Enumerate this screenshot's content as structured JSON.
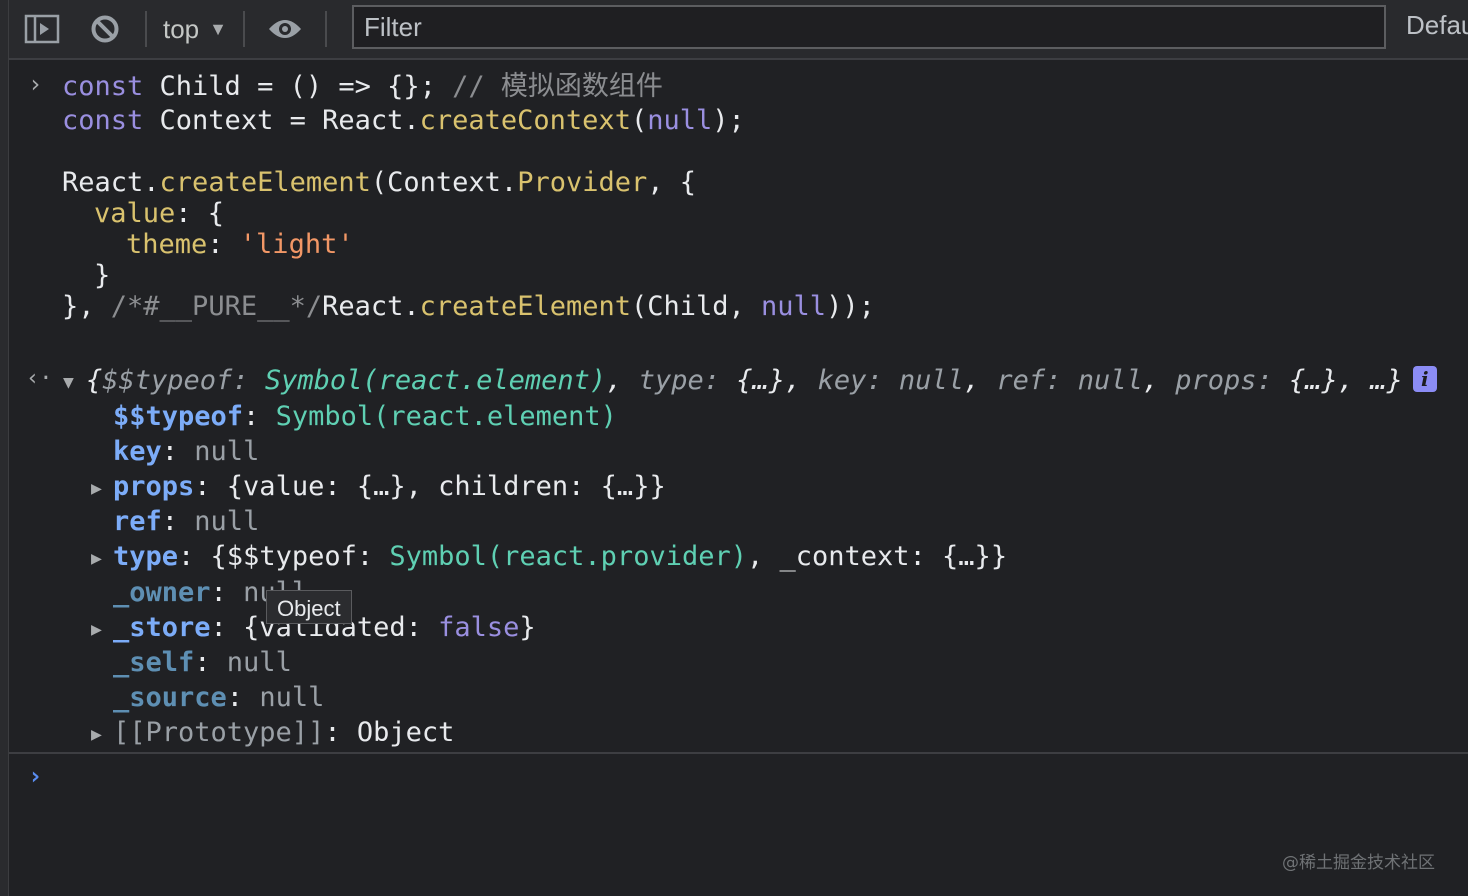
{
  "toolbar": {
    "context": "top",
    "filter_placeholder": "Filter",
    "levels_label": "Defau",
    "icons": [
      "sidebar-toggle-icon",
      "clear-console-icon",
      "eye-icon"
    ]
  },
  "input_code": {
    "l1": {
      "kw": "const",
      "ident": " Child = () => {}; ",
      "comment": "// 模拟函数组件"
    },
    "l2": {
      "kw": "const",
      "a": " Context = React.",
      "fn": "createContext",
      "b": "(",
      "nul": "null",
      "c": ");"
    },
    "l3": {
      "a": "React.",
      "fn": "createElement",
      "b": "(Context.",
      "prop": "Provider",
      "c": ", {"
    },
    "l4": {
      "prop": "value",
      "a": ": {"
    },
    "l5": {
      "prop": "theme",
      "a": ": ",
      "str": "'light'"
    },
    "l6": {
      "a": "}"
    },
    "l7": {
      "a": "}, ",
      "cmt": "/*#__PURE__*/",
      "b": "React.",
      "fn": "createElement",
      "c": "(Child, ",
      "nul": "null",
      "d": "));"
    }
  },
  "result": {
    "summary": {
      "open": "{",
      "k1": "$$typeof",
      "v1": "Symbol(react.element)",
      "k2": "type",
      "v2": "{…}",
      "k3": "key",
      "v3": "null",
      "k4": "ref",
      "v4": "null",
      "k5": "props",
      "v5": "{…}",
      "tail": "…}"
    },
    "rows": [
      {
        "key": "$$typeof",
        "value": "Symbol(react.element)"
      },
      {
        "key": "key",
        "value": "null"
      },
      {
        "key": "props",
        "value_a": "{value: {…}, ",
        "value_b": "children: {…}}"
      },
      {
        "key": "ref",
        "value": "null"
      },
      {
        "key": "type",
        "value_a": "{$$typeof: ",
        "value_sym": "Symbol(react.provider)",
        "value_b": ", _context: {…}}"
      },
      {
        "key": "_owner",
        "value": "null"
      },
      {
        "key": "_store",
        "value_a": "{validated: ",
        "value_bool": "false",
        "value_b": "}"
      },
      {
        "key": "_self",
        "value": "null"
      },
      {
        "key": "_source",
        "value": "null"
      },
      {
        "key": "[[Prototype]]",
        "value": "Object"
      }
    ]
  },
  "tooltip": "Object",
  "watermark": "@稀土掘金技术社区"
}
